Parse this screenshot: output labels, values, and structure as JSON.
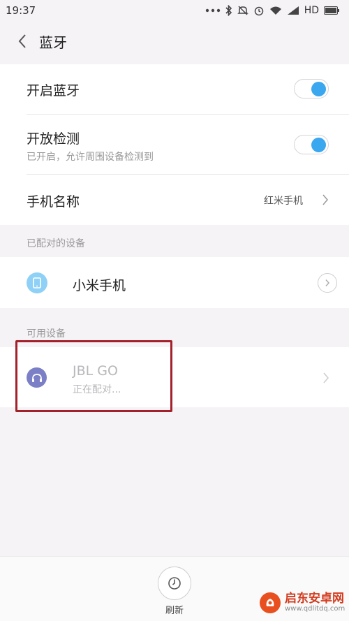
{
  "status_bar": {
    "time": "19:37",
    "network_label": "HD"
  },
  "header": {
    "title": "蓝牙"
  },
  "settings": {
    "bluetooth_label": "开启蓝牙",
    "bluetooth_on": true,
    "discoverable_label": "开放检测",
    "discoverable_sub": "已开启，允许周围设备检测到",
    "discoverable_on": true,
    "device_name_label": "手机名称",
    "device_name_value": "红米手机"
  },
  "paired": {
    "section_label": "已配对的设备",
    "devices": [
      {
        "name": "小米手机",
        "icon": "phone-icon"
      }
    ]
  },
  "available": {
    "section_label": "可用设备",
    "devices": [
      {
        "name": "JBL GO",
        "status": "正在配对...",
        "icon": "headphones-icon"
      }
    ]
  },
  "bottom": {
    "refresh_label": "刷新"
  },
  "watermark": {
    "title": "启东安卓网",
    "url": "www.qdlitdq.com"
  },
  "colors": {
    "accent": "#3ba7ef",
    "headphone_icon": "#7b7fc6",
    "highlight": "#a3212a"
  }
}
